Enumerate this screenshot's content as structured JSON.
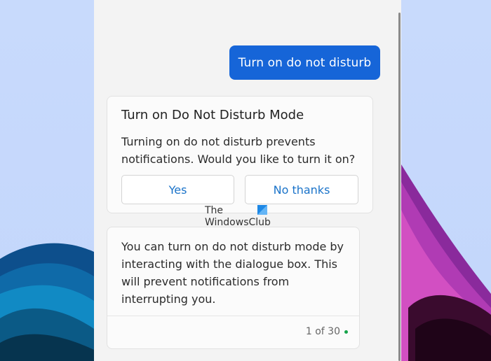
{
  "user_message": "Turn on do not disturb",
  "dialog": {
    "title": "Turn on Do Not Disturb Mode",
    "body": "Turning on do not disturb prevents notifications. Would you like to turn it on?",
    "yes_label": "Yes",
    "no_label": "No thanks"
  },
  "response": {
    "body": "You can turn on do not disturb mode by interacting with the dialogue box. This will prevent notifications from interrupting you.",
    "counter": "1 of 30"
  },
  "watermark": {
    "line1": "The",
    "line2": "WindowsClub"
  },
  "colors": {
    "accent": "#1665d8",
    "link": "#1a73c9",
    "status_dot": "#16a34a"
  }
}
